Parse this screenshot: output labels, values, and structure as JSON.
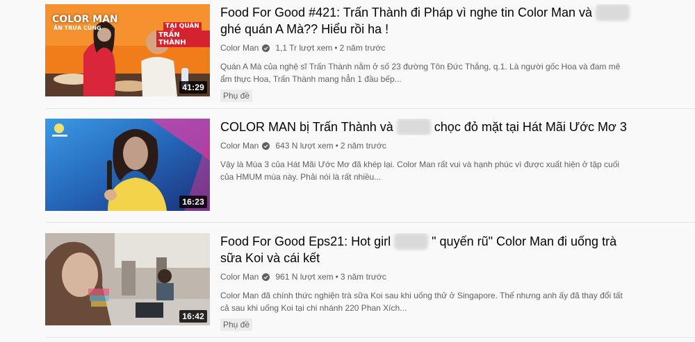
{
  "results": [
    {
      "title_before": "Food For Good #421: Trấn Thành đi Pháp vì nghe tin Color Man và",
      "title_blurred": "xxxxx",
      "title_after": "ghé quán A Mà?? Hiểu rồi ha !",
      "channel": "Color Man",
      "views": "1,1 Tr lượt xem",
      "age": "2 năm trước",
      "description": "Quán A Mà của nghệ sĩ Trấn Thành nằm ở số 23 đường Tôn Đức Thắng, q.1. Là người gốc Hoa và đam mê ẩm thực Hoa, Trấn Thành mang hẳn 1 đầu bếp...",
      "duration": "41:29",
      "badge": "Phụ đề",
      "thumb_text": {
        "brand": "COLOR MAN",
        "brand_sub": "ĂN TRƯA CÙNG",
        "venue_top": "TẠI QUÁN",
        "venue_bottom": "TRẤN THÀNH"
      }
    },
    {
      "title_before": "COLOR MAN bị Trấn Thành và",
      "title_blurred": "xxxxx",
      "title_after": "chọc đỏ mặt tại Hát Mãi Ước Mơ 3",
      "channel": "Color Man",
      "views": "643 N lượt xem",
      "age": "2 năm trước",
      "description": "Vậy là Mùa 3 của Hát Mãi Ước Mơ đã khép lại. Color Man rất vui và hạnh phúc vì được xuất hiện ở tập cuối của HMUM mùa này. Phải nói là rất nhiều...",
      "duration": "16:23",
      "badge": ""
    },
    {
      "title_before": "Food For Good Eps21: Hot girl",
      "title_blurred": "xxxxx",
      "title_after": "\" quyến rũ\" Color Man đi uống trà sữa Koi và cái kết",
      "channel": "Color Man",
      "views": "961 N lượt xem",
      "age": "3 năm trước",
      "description": "Color Man đã chính thức nghiện trà sữa Koi sau khi uống thử ở Singapore. Thế nhưng anh ấy đã thay đổi tất cả sau khi uống Koi tại chi nhánh 220 Phan Xích...",
      "duration": "16:42",
      "badge": "Phụ đề"
    }
  ],
  "separator": "•",
  "icons": {
    "verified": "verified-checkmark-icon"
  },
  "colors": {
    "thumb1_bg": "#f07d1a",
    "thumb2_bg": "#2f7fd0",
    "thumb3_bg": "#bfb7ad"
  }
}
